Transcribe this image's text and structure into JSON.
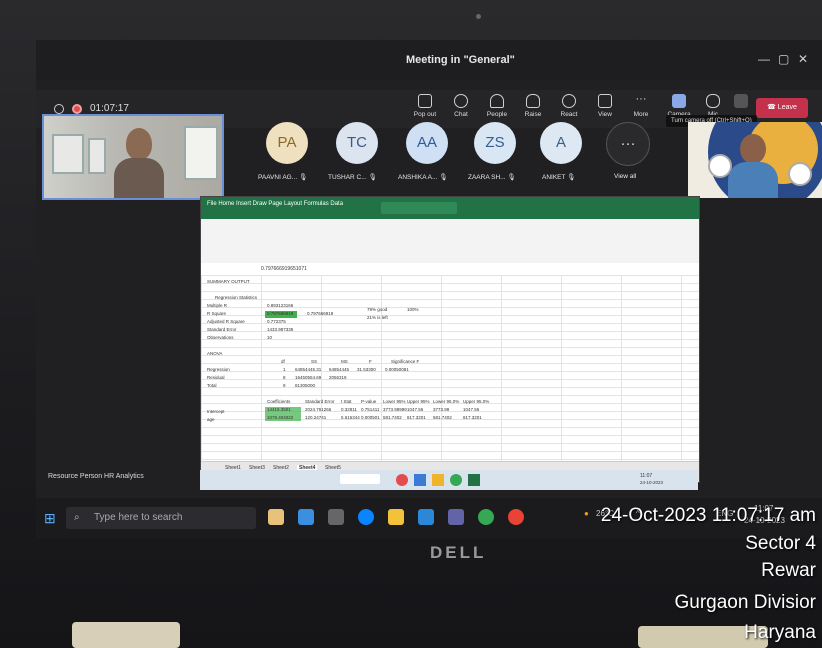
{
  "meeting": {
    "window_title": "Meeting in \"General\"",
    "timer": "01:07:17",
    "toolbar": [
      {
        "label": "Pop out",
        "icon": "popout-icon"
      },
      {
        "label": "Chat",
        "icon": "chat-icon"
      },
      {
        "label": "People",
        "icon": "people-icon",
        "count": "10"
      },
      {
        "label": "Raise",
        "icon": "raise-hand-icon"
      },
      {
        "label": "React",
        "icon": "react-icon"
      },
      {
        "label": "View",
        "icon": "view-icon"
      },
      {
        "label": "More",
        "icon": "more-icon"
      },
      {
        "label": "Camera",
        "icon": "camera-icon"
      },
      {
        "label": "Mic",
        "icon": "mic-icon"
      }
    ],
    "leave_label": "Leave",
    "tooltip": "Turn camera off (Ctrl+Shift+O)",
    "participants": [
      {
        "initials": "PA",
        "name": "PAAVNI AG...",
        "bg": "#efe1c0",
        "fg": "#8a6a2a"
      },
      {
        "initials": "TC",
        "name": "TUSHAR C...",
        "bg": "#dce4f0",
        "fg": "#3c5a8a"
      },
      {
        "initials": "AA",
        "name": "ANSHIKA A...",
        "bg": "#cfe0f5",
        "fg": "#2f5c99"
      },
      {
        "initials": "ZS",
        "name": "ZAARA SH...",
        "bg": "#d9e6f3",
        "fg": "#345f8f"
      },
      {
        "initials": "A",
        "name": "ANIKET",
        "bg": "#dde8f2",
        "fg": "#3a5f85"
      }
    ],
    "view_all_label": "View all",
    "presenter_label": "Resource Person HR Analytics"
  },
  "excel": {
    "formula_value": "0.797666919651071",
    "summary_title": "SUMMARY OUTPUT",
    "reg_stats_title": "Regression Statistics",
    "rows": [
      {
        "label": "Multiple R",
        "value": "0.893123166"
      },
      {
        "label": "R Square",
        "value": "0.797666919"
      },
      {
        "label": "Adjusted R Square",
        "value": "0.772375"
      },
      {
        "label": "Standard Error",
        "value": "1433.987335"
      },
      {
        "label": "Observations",
        "value": "10"
      }
    ],
    "note_value": "0.797666919",
    "note1": "79% good",
    "note1b": "100%",
    "note2": "21% is left",
    "anova_title": "ANOVA",
    "anova_headers": [
      "df",
      "SS",
      "MS",
      "F",
      "Significance F"
    ],
    "anova_rows": [
      {
        "label": "Regression",
        "values": [
          "1",
          "64854445.31",
          "64854445",
          "31.53300",
          "0.00050081"
        ]
      },
      {
        "label": "Residual",
        "values": [
          "8",
          "16450554.69",
          "2056319",
          "",
          ""
        ]
      },
      {
        "label": "Total",
        "values": [
          "9",
          "81305000",
          "",
          "",
          ""
        ]
      }
    ],
    "coef_headers": [
      "Coefficients",
      "Standard Error",
      "t Stat",
      "P-value",
      "Lower 95%",
      "Upper 95%",
      "Lower 95.0%",
      "Upper 95.0%"
    ],
    "coef_rows": [
      {
        "label": "Intercept",
        "values": [
          "14415.3501",
          "2024.761266",
          "0.32811",
          "0.751411",
          "3773.98999",
          "1047.56",
          "3773.99",
          "1047.56"
        ]
      },
      {
        "label": "age",
        "values": [
          "1079.404022",
          "120.24741",
          "5.615344",
          "0.000501",
          "581.7402",
          "817.3201",
          "581.7402",
          "817.3201"
        ]
      }
    ],
    "sheets": [
      "Sheet1",
      "Sheet3",
      "Sheet2",
      "Sheet4",
      "Sheet5"
    ],
    "active_sheet": "Sheet4",
    "inner_clock": "11:07",
    "inner_date": "24-10-2023"
  },
  "desktop": {
    "search_placeholder": "Type here to search",
    "temperature": "26°C",
    "lang": "ENG",
    "time": "11:07",
    "date": "24-10-2023"
  },
  "stamp": {
    "datetime": "24-Oct-2023 11:07:17 am",
    "line2": "Sector 4",
    "line3": "Rewar",
    "line4": "Gurgaon Divisior",
    "line5": "Haryana"
  },
  "brand": "DELL",
  "colors": {
    "leave": "#c4314b",
    "excel_green": "#217346",
    "highlight": "#3fb24a",
    "selfview_border": "#6a8fd8"
  }
}
